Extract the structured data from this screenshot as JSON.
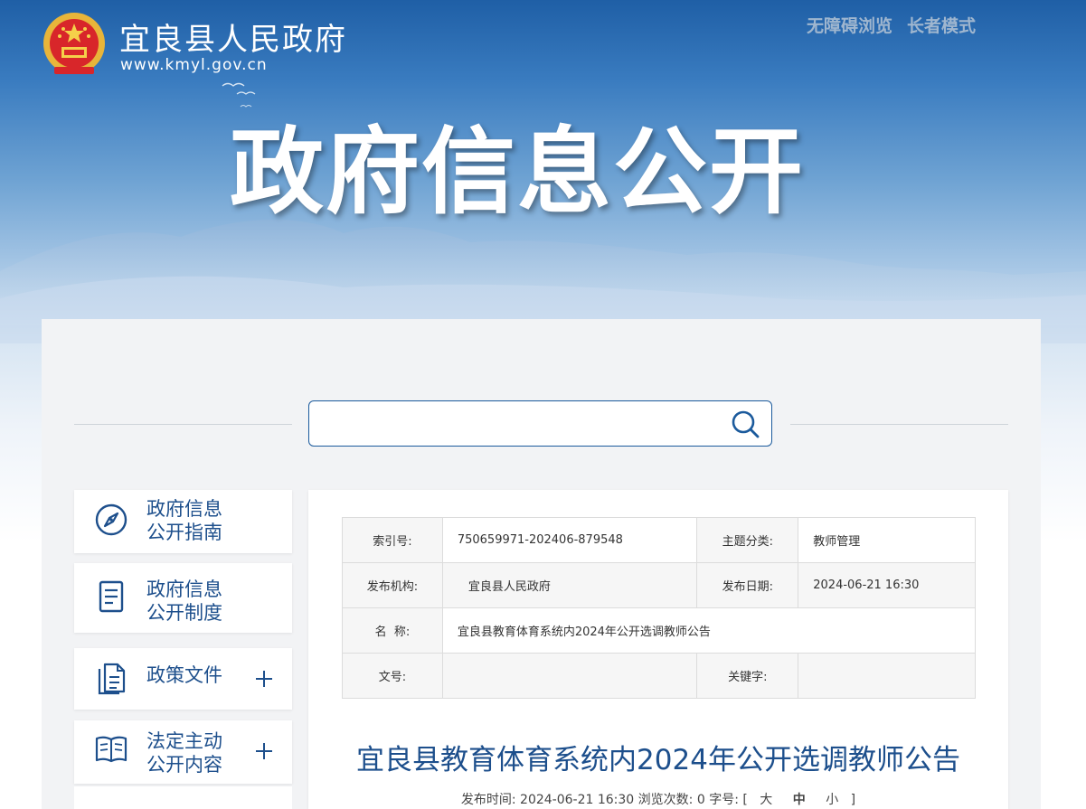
{
  "header": {
    "site_title": "宜良县人民政府",
    "site_url": "www.kmyl.gov.cn",
    "links": [
      "无障碍浏览",
      "长者模式"
    ],
    "hero_title": "政府信息公开"
  },
  "colors": {
    "accent": "#1d4f8c",
    "banner_top": "#1f5fa6",
    "link_muted": "#9fb6cf"
  },
  "search": {
    "value": "",
    "placeholder": ""
  },
  "sidebar": {
    "items": [
      {
        "label": "政府信息\n公开指南",
        "icon": "compass-icon",
        "expandable": false
      },
      {
        "label": "政府信息\n公开制度",
        "icon": "document-icon",
        "expandable": false
      },
      {
        "label": "政策文件",
        "icon": "files-icon",
        "expandable": true
      },
      {
        "label": "法定主动\n公开内容",
        "icon": "book-icon",
        "expandable": true
      }
    ]
  },
  "meta": {
    "index_label": "索引号:",
    "index_value": "750659971-202406-879548",
    "topic_label": "主题分类:",
    "topic_value": "教师管理",
    "org_label": "发布机构:",
    "org_value": "宜良县人民政府",
    "date_label": "发布日期:",
    "date_value": "2024-06-21 16:30",
    "name_label": "名  称:",
    "name_value": "宜良县教育体育系统内2024年公开选调教师公告",
    "docno_label": "文号:",
    "docno_value": "",
    "keyword_label": "关键字:",
    "keyword_value": ""
  },
  "document": {
    "title": "宜良县教育体育系统内2024年公开选调教师公告",
    "publish_label": "发布时间:",
    "publish_time": "2024-06-21 16:30",
    "views_label": "浏览次数:",
    "views": "0",
    "fontsize_label": "字号:",
    "bracket_open": "[",
    "bracket_close": "]",
    "font_sizes": [
      "大",
      "中",
      "小"
    ]
  }
}
